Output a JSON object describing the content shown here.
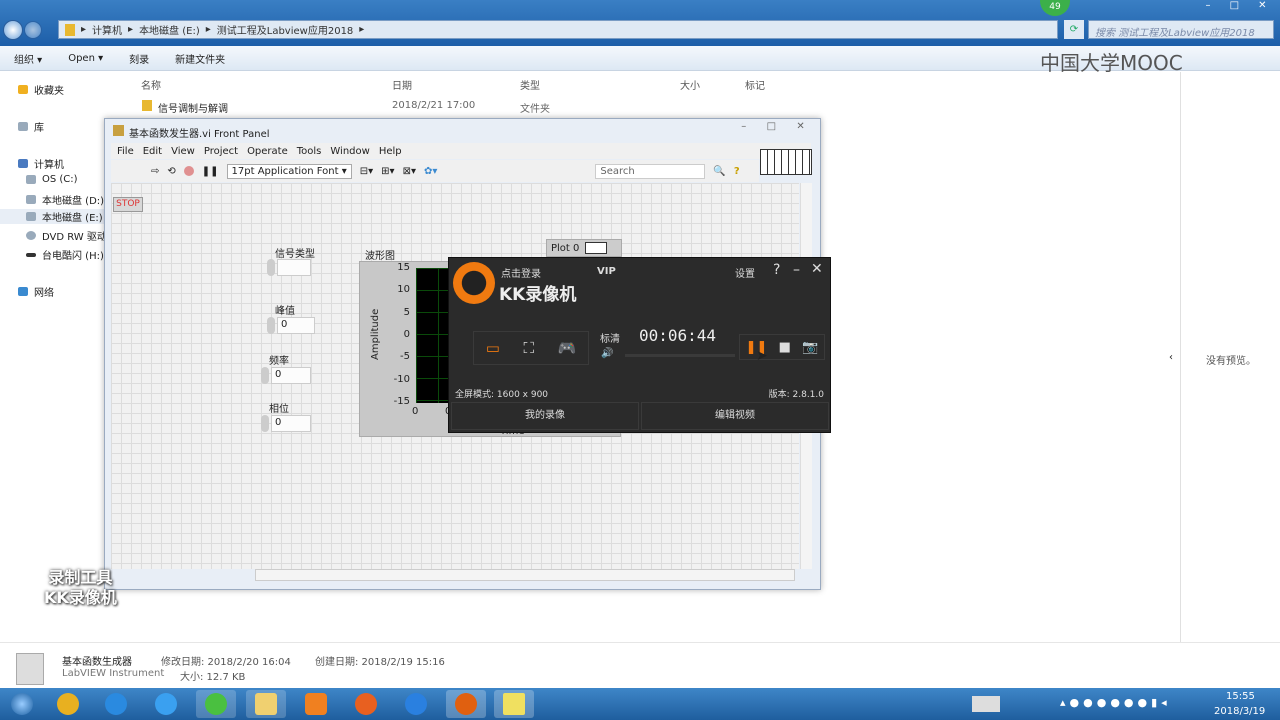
{
  "explorer": {
    "breadcrumb": [
      "计算机",
      "本地磁盘 (E:)",
      "测试工程及Labview应用2018"
    ],
    "search_placeholder": "搜索 测试工程及Labview应用2018",
    "badge": "49",
    "toolbar": [
      "组织 ▾",
      "Open ▾",
      "刻录",
      "新建文件夹"
    ],
    "columns": [
      "名称",
      "日期",
      "类型",
      "大小",
      "标记"
    ],
    "files": [
      {
        "name": "信号调制与解调",
        "date": "2018/2/21 17:00",
        "type": "文件夹"
      }
    ],
    "sidebar": [
      "收藏夹",
      "库",
      "计算机",
      "OS (C:)",
      "本地磁盘 (D:)",
      "本地磁盘 (E:)",
      "DVD RW 驱动",
      "台电酷闪 (H:)",
      "网络"
    ],
    "preview": "没有预览。",
    "details": {
      "name": "基本函数生成器",
      "type": "LabVIEW Instrument",
      "modified": "修改日期: 2018/2/20 16:04",
      "created": "创建日期: 2018/2/19 15:16",
      "size": "大小: 12.7 KB"
    },
    "watermark": "中国大学MOOC"
  },
  "labview": {
    "title": "基本函数发生器.vi Front Panel",
    "menu": [
      "File",
      "Edit",
      "View",
      "Project",
      "Operate",
      "Tools",
      "Window",
      "Help"
    ],
    "font": "17pt Application Font",
    "search": "Search",
    "stop": "STOP",
    "controls": [
      {
        "label": "信号类型",
        "value": ""
      },
      {
        "label": "峰值",
        "value": "0"
      },
      {
        "label": "频率",
        "value": "0"
      },
      {
        "label": "相位",
        "value": "0"
      }
    ],
    "graph": {
      "title": "波形图",
      "ylabel": "Amplitude",
      "xlabel": "Time",
      "legend": "Plot 0",
      "yticks": [
        "15",
        "10",
        "5",
        "0",
        "-5",
        "-10",
        "-15"
      ],
      "xticks": [
        "0",
        "0"
      ]
    }
  },
  "kk": {
    "login": "点击登录",
    "vip": "VIP",
    "name": "KK录像机",
    "settings": "设置",
    "quality": "标清",
    "timer": "00:06:44",
    "mode": "全屏模式: 1600 x 900",
    "version": "版本: 2.8.1.0",
    "my_videos": "我的录像",
    "edit_video": "编辑视频",
    "accent": "#f07a10",
    "watermark": [
      "录制工具",
      "KK录像机"
    ]
  },
  "clock": {
    "time": "15:55",
    "date": "2018/3/19"
  }
}
